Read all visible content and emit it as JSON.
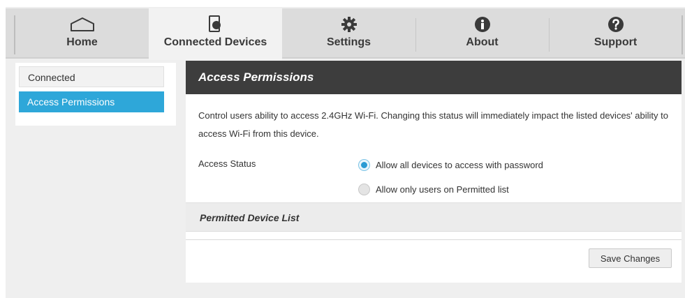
{
  "nav": {
    "tabs": [
      {
        "label": "Home",
        "icon": "home-icon"
      },
      {
        "label": "Connected Devices",
        "icon": "phone-icon",
        "active": true
      },
      {
        "label": "Settings",
        "icon": "gear-icon"
      },
      {
        "label": "About",
        "icon": "info-icon"
      },
      {
        "label": "Support",
        "icon": "help-icon"
      }
    ]
  },
  "sidebar": {
    "items": [
      {
        "label": "Connected"
      },
      {
        "label": "Access Permissions",
        "selected": true
      }
    ]
  },
  "panel": {
    "title": "Access Permissions",
    "description": "Control users ability to access 2.4GHz Wi-Fi. Changing this status will immediately impact the listed devices' ability to access Wi-Fi from this device.",
    "access_status_label": "Access Status",
    "options": [
      {
        "label": "Allow all devices to access with password",
        "checked": true
      },
      {
        "label": "Allow only users on Permitted list",
        "checked": false
      }
    ],
    "permitted_list_title": "Permitted Device List",
    "save_label": "Save Changes"
  },
  "colors": {
    "accent": "#2ea7d9",
    "header_dark": "#3d3d3d",
    "nav_bg": "#dcdcdc"
  }
}
